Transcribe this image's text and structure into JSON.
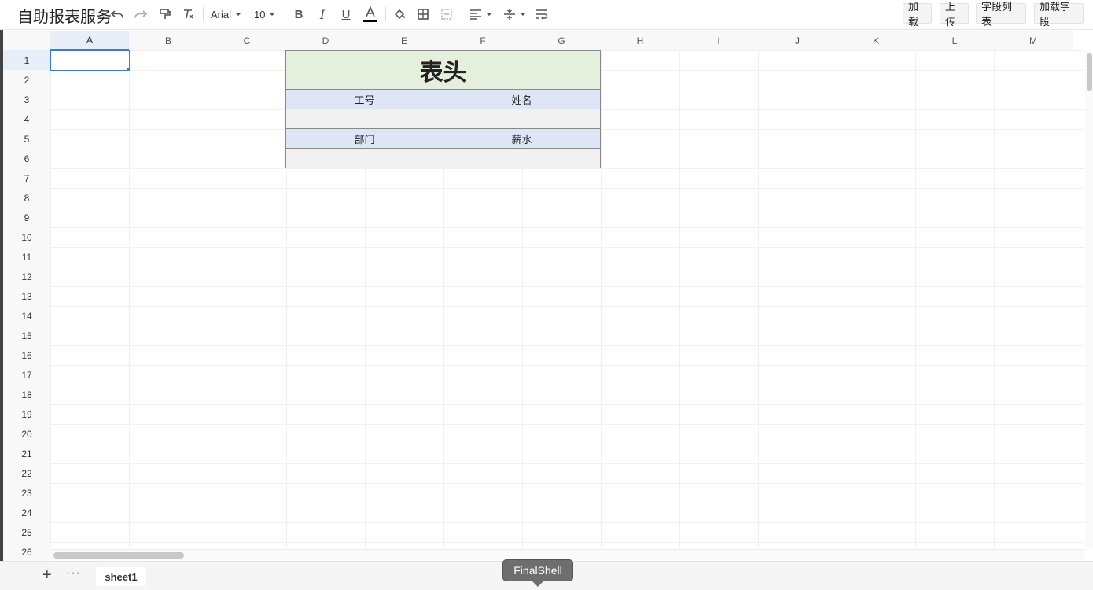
{
  "app": {
    "title": "自助报表服务"
  },
  "toolbar": {
    "font_family": "Arial",
    "font_size": "10",
    "text_color": "#000000",
    "icons": [
      "undo-icon",
      "redo-icon",
      "format-painter-icon",
      "clear-format-icon",
      "bold-icon",
      "italic-icon",
      "underline-icon",
      "text-color-icon",
      "fill-color-icon",
      "borders-icon",
      "merge-cells-icon",
      "align-horizontal-icon",
      "align-vertical-icon",
      "wrap-text-icon"
    ],
    "buttons": {
      "load": "加载",
      "upload": "上传",
      "field_list": "字段列表",
      "load_fields": "加载字段"
    }
  },
  "grid": {
    "columns": [
      "A",
      "B",
      "C",
      "D",
      "E",
      "F",
      "G",
      "H",
      "I",
      "J",
      "K",
      "L",
      "M"
    ],
    "rows": [
      "1",
      "2",
      "3",
      "4",
      "5",
      "6",
      "7",
      "8",
      "9",
      "10",
      "11",
      "12",
      "13",
      "14",
      "15",
      "16",
      "17",
      "18",
      "19",
      "20",
      "21",
      "22",
      "23",
      "24",
      "25",
      "26"
    ],
    "selected_cell": "A1",
    "selection_color": "#3b7ad9"
  },
  "report": {
    "header": "表头",
    "header_bg": "#e4efdc",
    "label_bg": "#dce6f6",
    "value_bg": "#f1f1f1",
    "employee_id_label": "工号",
    "name_label": "姓名",
    "department_label": "部门",
    "salary_label": "薪水"
  },
  "sheets": {
    "tabs": [
      "sheet1"
    ]
  },
  "tooltip": {
    "text": "FinalShell"
  }
}
